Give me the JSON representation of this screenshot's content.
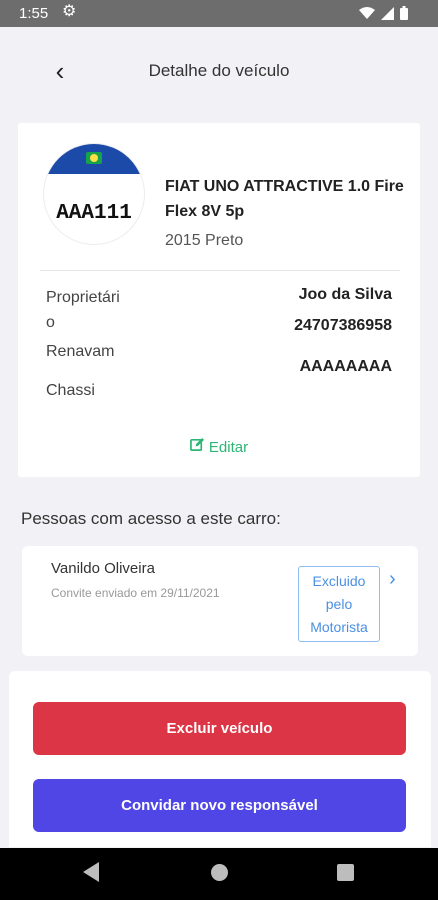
{
  "statusbar": {
    "time": "1:55"
  },
  "header": {
    "title": "Detalhe do veículo"
  },
  "vehicle": {
    "plate": "AAA111",
    "model": "FIAT UNO ATTRACTIVE 1.0 Fire Flex 8V 5p",
    "year_color": "2015 Preto",
    "owner_label": "Proprietári\no",
    "owner_value": "Joo da Silva",
    "renavam_label": "Renavam",
    "renavam_value": "24707386958",
    "chassi_label": "Chassi",
    "chassi_value": "AAAAAAAA",
    "edit_label": "Editar"
  },
  "access": {
    "section_title": "Pessoas com acesso a este carro:",
    "people": [
      {
        "name": "Vanildo Oliveira",
        "invite": "Convite enviado em 29/11/2021",
        "status": "Excluido pelo Motorista"
      }
    ]
  },
  "actions": {
    "delete_label": "Excluir veículo",
    "invite_label": "Convidar novo responsável"
  },
  "colors": {
    "danger": "#dc3545",
    "primary": "#4f46e5",
    "success": "#2bb673",
    "link": "#4a90e2"
  }
}
